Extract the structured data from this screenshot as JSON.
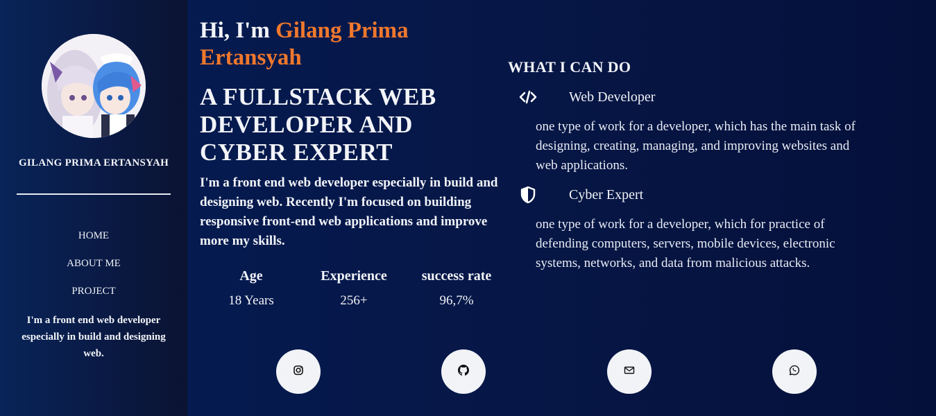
{
  "profile": {
    "name": "GILANG PRIMA ERTANSYAH",
    "bio": "I'm a front end web developer especially in build and designing web."
  },
  "nav": [
    {
      "label": "HOME"
    },
    {
      "label": "ABOUT ME"
    },
    {
      "label": "PROJECT"
    }
  ],
  "hero": {
    "greeting": "Hi, I'm ",
    "name": "Gilang Prima Ertansyah",
    "headline": "A FULLSTACK WEB DEVELOPER AND CYBER EXPERT",
    "intro": "I'm a front end web developer especially in build and designing web. Recently I'm focused on building responsive front-end web applications and improve more my skills."
  },
  "stats": [
    {
      "label": "Age",
      "value": "18 Years"
    },
    {
      "label": "Experience",
      "value": "256+"
    },
    {
      "label": "success rate",
      "value": "96,7%"
    }
  ],
  "services": {
    "title": "WHAT I CAN DO",
    "items": [
      {
        "icon": "code-icon",
        "name": "Web Developer",
        "description": "one type of work for a developer, which has the main task of designing, creating, managing, and improving websites and web applications."
      },
      {
        "icon": "shield-icon",
        "name": "Cyber Expert",
        "description": "one type of work for a developer, which for practice of defending computers, servers, mobile devices, electronic systems, networks, and data from malicious attacks."
      }
    ]
  },
  "social": [
    {
      "icon": "instagram-icon"
    },
    {
      "icon": "github-icon"
    },
    {
      "icon": "mail-icon"
    },
    {
      "icon": "whatsapp-icon"
    }
  ],
  "colors": {
    "accent": "#f0782d",
    "background": "#061645",
    "sidebar": "#082458",
    "text": "#f2f4f8"
  }
}
